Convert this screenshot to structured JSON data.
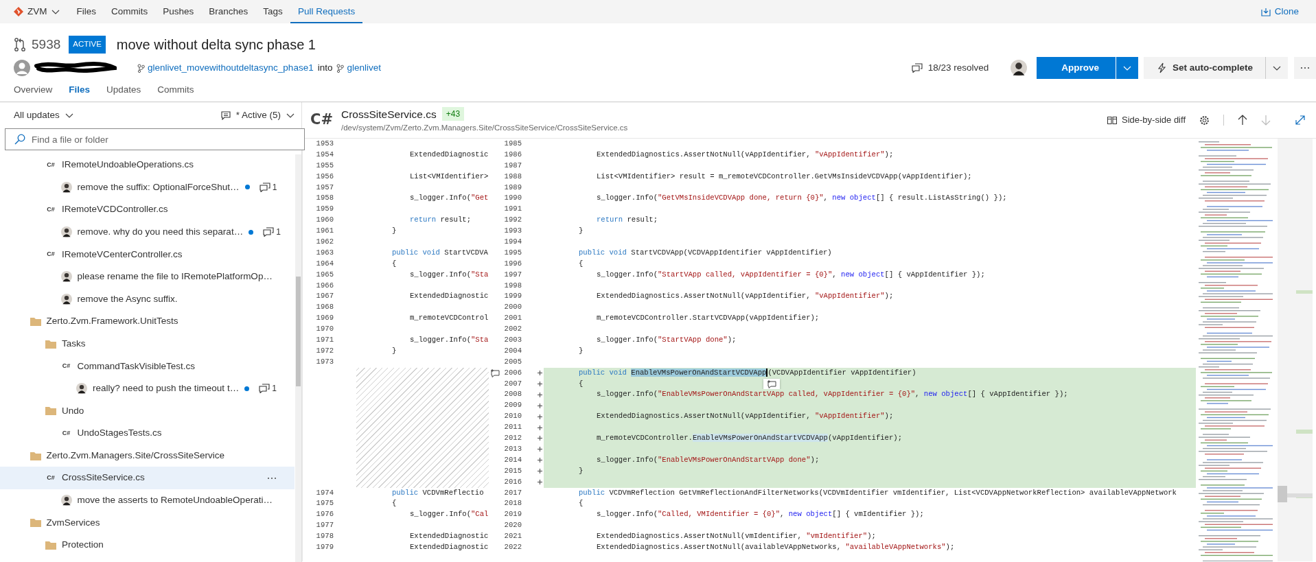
{
  "nav": {
    "project": "ZVM",
    "items": [
      {
        "label": "Files",
        "selected": false
      },
      {
        "label": "Commits",
        "selected": false
      },
      {
        "label": "Pushes",
        "selected": false
      },
      {
        "label": "Branches",
        "selected": false
      },
      {
        "label": "Tags",
        "selected": false
      },
      {
        "label": "Pull Requests",
        "selected": true
      }
    ],
    "clone": "Clone"
  },
  "pull_request": {
    "id": "5938",
    "status": "ACTIVE",
    "title": "move without delta sync phase 1",
    "source_branch": "glenlivet_movewithoutdeltasync_phase1",
    "joiner": "into",
    "target_branch": "glenlivet",
    "resolved": "18/23 resolved",
    "approve": "Approve",
    "auto_complete": "Set auto-complete",
    "tabs": [
      {
        "label": "Overview",
        "selected": false
      },
      {
        "label": "Files",
        "selected": true
      },
      {
        "label": "Updates",
        "selected": false
      },
      {
        "label": "Commits",
        "selected": false
      }
    ]
  },
  "sidebar": {
    "updates_filter": "All updates",
    "comments_filter": "* Active (5)",
    "search": {
      "placeholder": "Find a file or folder"
    },
    "tree": [
      {
        "kind": "folder",
        "children": [
          {
            "kind": "file",
            "language": "C#",
            "label": "IRemoteUndoableOperations.cs",
            "selected": false,
            "children": [
              {
                "kind": "comment",
                "text": "remove the suffix: OptionalForceShut…",
                "unread": true,
                "replies": "1",
                "selected": false
              }
            ]
          },
          {
            "kind": "file",
            "language": "C#",
            "label": "IRemoteVCDController.cs",
            "selected": false,
            "children": [
              {
                "kind": "comment",
                "text": "remove. why do you need this separat…",
                "unread": true,
                "replies": "1",
                "selected": false
              }
            ]
          },
          {
            "kind": "file",
            "language": "C#",
            "label": "IRemoteVCenterController.cs",
            "selected": false,
            "children": [
              {
                "kind": "comment",
                "text": "please rename the file to IRemotePlatformOp…",
                "unread": false,
                "selected": false
              },
              {
                "kind": "comment",
                "text": "remove the Async suffix.",
                "unread": false,
                "selected": false
              }
            ]
          }
        ]
      },
      {
        "kind": "folder",
        "label": "Zerto.Zvm.Framework.UnitTests",
        "selected": false,
        "children": [
          {
            "kind": "folder",
            "label": "Tasks",
            "selected": false,
            "children": [
              {
                "kind": "file",
                "language": "C#",
                "label": "CommandTaskVisibleTest.cs",
                "selected": false,
                "children": [
                  {
                    "kind": "comment",
                    "text": "really? need to push the timeout t…",
                    "unread": true,
                    "replies": "1",
                    "selected": false
                  }
                ]
              }
            ]
          },
          {
            "kind": "folder",
            "label": "Undo",
            "selected": false,
            "children": [
              {
                "kind": "file",
                "language": "C#",
                "label": "UndoStagesTests.cs",
                "selected": false
              }
            ]
          }
        ]
      },
      {
        "kind": "folder",
        "label": "Zerto.Zvm.Managers.Site/CrossSiteService",
        "selected": false,
        "children": [
          {
            "kind": "file",
            "language": "C#",
            "label": "CrossSiteService.cs",
            "selected": true,
            "children": [
              {
                "kind": "comment",
                "text": "move the asserts to RemoteUndoableOperati…",
                "unread": false,
                "selected": false
              }
            ]
          }
        ]
      },
      {
        "kind": "folder",
        "label": "ZvmServices",
        "selected": false,
        "children": [
          {
            "kind": "folder",
            "label": "Protection",
            "selected": false
          }
        ]
      }
    ]
  },
  "file": {
    "language": "C#",
    "name": "CrossSiteService.cs",
    "added": "+43",
    "path": "/dev/system/Zvm/Zerto.Zvm.Managers.Site/CrossSiteService/CrossSiteService.cs",
    "view": "Side-by-side diff"
  },
  "diff": {
    "rows": [
      {
        "left": {
          "number": "1953"
        },
        "right": {
          "number": "1985"
        }
      },
      {
        "kind": "body",
        "left": {
          "number": "1954",
          "code": [
            {
              "kind": "plain",
              "text": "ExtendedDiagnostic"
            }
          ]
        },
        "right": {
          "number": "1986",
          "code": [
            {
              "kind": "plain",
              "text": "ExtendedDiagnostics.AssertNotNull(vAppIdentifier, "
            },
            {
              "kind": "string",
              "text": "\"vAppIdentifier\""
            },
            {
              "kind": "plain",
              "text": ");"
            }
          ]
        }
      },
      {
        "left": {
          "number": "1955"
        },
        "right": {
          "number": "1987"
        }
      },
      {
        "kind": "body",
        "left": {
          "number": "1956",
          "code": [
            {
              "kind": "plain",
              "text": "List<VMIdentifier>"
            }
          ]
        },
        "right": {
          "number": "1988",
          "code": [
            {
              "kind": "plain",
              "text": "List<VMIdentifier> result = m_remoteVCDController.GetVMsInsideVCDVApp(vAppIdentifier);"
            }
          ]
        }
      },
      {
        "left": {
          "number": "1957"
        },
        "right": {
          "number": "1989"
        }
      },
      {
        "kind": "body",
        "left": {
          "number": "1958",
          "code": [
            {
              "kind": "plain",
              "text": "s_logger.Info("
            },
            {
              "kind": "string",
              "text": "\"Get"
            }
          ]
        },
        "right": {
          "number": "1990",
          "code": [
            {
              "kind": "plain",
              "text": "s_logger.Info("
            },
            {
              "kind": "string",
              "text": "\"GetVMsInsideVCDVApp done, return {0}\""
            },
            {
              "kind": "plain",
              "text": ", "
            },
            {
              "kind": "new-keyword",
              "text": "new object"
            },
            {
              "kind": "plain",
              "text": "[] { result.ListAsString() });"
            }
          ]
        }
      },
      {
        "left": {
          "number": "1959"
        },
        "right": {
          "number": "1991"
        }
      },
      {
        "kind": "body",
        "left": {
          "number": "1960",
          "code": [
            {
              "kind": "keyword",
              "text": "return"
            },
            {
              "kind": "plain",
              "text": " result;"
            }
          ]
        },
        "right": {
          "number": "1992",
          "code": [
            {
              "kind": "keyword",
              "text": "return"
            },
            {
              "kind": "plain",
              "text": " result;"
            }
          ]
        }
      },
      {
        "kind": "member",
        "left": {
          "number": "1961",
          "code": [
            {
              "kind": "plain",
              "text": "}"
            }
          ]
        },
        "right": {
          "number": "1993",
          "code": [
            {
              "kind": "plain",
              "text": "}"
            }
          ]
        }
      },
      {
        "left": {
          "number": "1962"
        },
        "right": {
          "number": "1994"
        }
      },
      {
        "kind": "member",
        "left": {
          "number": "1963",
          "code": [
            {
              "kind": "keyword",
              "text": "public void"
            },
            {
              "kind": "plain",
              "text": " StartVCDVA"
            }
          ]
        },
        "right": {
          "number": "1995",
          "code": [
            {
              "kind": "keyword",
              "text": "public void"
            },
            {
              "kind": "plain",
              "text": " StartVCDVApp(VCDVAppIdentifier vAppIdentifier)"
            }
          ]
        }
      },
      {
        "kind": "member",
        "left": {
          "number": "1964",
          "code": [
            {
              "kind": "plain",
              "text": "{"
            }
          ]
        },
        "right": {
          "number": "1996",
          "code": [
            {
              "kind": "plain",
              "text": "{"
            }
          ]
        }
      },
      {
        "kind": "body",
        "left": {
          "number": "1965",
          "code": [
            {
              "kind": "plain",
              "text": "s_logger.Info("
            },
            {
              "kind": "string",
              "text": "\"Sta"
            }
          ]
        },
        "right": {
          "number": "1997",
          "code": [
            {
              "kind": "plain",
              "text": "s_logger.Info("
            },
            {
              "kind": "string",
              "text": "\"StartVApp called, vAppIdentifier = {0}\""
            },
            {
              "kind": "plain",
              "text": ", "
            },
            {
              "kind": "new-keyword",
              "text": "new object"
            },
            {
              "kind": "plain",
              "text": "[] { vAppIdentifier });"
            }
          ]
        }
      },
      {
        "left": {
          "number": "1966"
        },
        "right": {
          "number": "1998"
        }
      },
      {
        "kind": "body",
        "left": {
          "number": "1967",
          "code": [
            {
              "kind": "plain",
              "text": "ExtendedDiagnostic"
            }
          ]
        },
        "right": {
          "number": "1999",
          "code": [
            {
              "kind": "plain",
              "text": "ExtendedDiagnostics.AssertNotNull(vAppIdentifier, "
            },
            {
              "kind": "string",
              "text": "\"vAppIdentifier\""
            },
            {
              "kind": "plain",
              "text": ");"
            }
          ]
        }
      },
      {
        "left": {
          "number": "1968"
        },
        "right": {
          "number": "2000"
        }
      },
      {
        "kind": "body",
        "left": {
          "number": "1969",
          "code": [
            {
              "kind": "plain",
              "text": "m_remoteVCDControl"
            }
          ]
        },
        "right": {
          "number": "2001",
          "code": [
            {
              "kind": "plain",
              "text": "m_remoteVCDController.StartVCDVApp(vAppIdentifier);"
            }
          ]
        }
      },
      {
        "left": {
          "number": "1970"
        },
        "right": {
          "number": "2002"
        }
      },
      {
        "kind": "body",
        "left": {
          "number": "1971",
          "code": [
            {
              "kind": "plain",
              "text": "s_logger.Info("
            },
            {
              "kind": "string",
              "text": "\"Sta"
            }
          ]
        },
        "right": {
          "number": "2003",
          "code": [
            {
              "kind": "plain",
              "text": "s_logger.Info("
            },
            {
              "kind": "string",
              "text": "\"StartVApp done\""
            },
            {
              "kind": "plain",
              "text": ");"
            }
          ]
        }
      },
      {
        "kind": "member",
        "left": {
          "number": "1972",
          "code": [
            {
              "kind": "plain",
              "text": "}"
            }
          ]
        },
        "right": {
          "number": "2004",
          "code": [
            {
              "kind": "plain",
              "text": "}"
            }
          ]
        }
      },
      {
        "left": {
          "number": "1973"
        },
        "right": {
          "number": "2005"
        }
      },
      {
        "added": true,
        "comment_marker": true,
        "kind": "member",
        "right": {
          "number": "2006",
          "code": [
            {
              "kind": "keyword",
              "text": "public void "
            },
            {
              "kind": "selection",
              "text": "EnableVMsPowerOnAndStartVCDVApp"
            },
            {
              "kind": "plain",
              "text": "(VCDVAppIdentifier vAppIdentifier)"
            }
          ]
        }
      },
      {
        "added": true,
        "comment_button": true,
        "kind": "member",
        "right": {
          "number": "2007",
          "code": [
            {
              "kind": "plain",
              "text": "{"
            }
          ]
        }
      },
      {
        "added": true,
        "kind": "body",
        "right": {
          "number": "2008",
          "code": [
            {
              "kind": "plain",
              "text": "s_logger.Info("
            },
            {
              "kind": "string",
              "text": "\"EnableVMsPowerOnAndStartVApp called, vAppIdentifier = {0}\""
            },
            {
              "kind": "plain",
              "text": ", "
            },
            {
              "kind": "new-keyword",
              "text": "new object"
            },
            {
              "kind": "plain",
              "text": "[] { vAppIdentifier });"
            }
          ]
        }
      },
      {
        "added": true,
        "right": {
          "number": "2009"
        }
      },
      {
        "added": true,
        "kind": "body",
        "right": {
          "number": "2010",
          "code": [
            {
              "kind": "plain",
              "text": "ExtendedDiagnostics.AssertNotNull(vAppIdentifier, "
            },
            {
              "kind": "string",
              "text": "\"vAppIdentifier\""
            },
            {
              "kind": "plain",
              "text": ");"
            }
          ]
        }
      },
      {
        "added": true,
        "right": {
          "number": "2011"
        }
      },
      {
        "added": true,
        "kind": "body",
        "right": {
          "number": "2012",
          "code": [
            {
              "kind": "plain",
              "text": "m_remoteVCDController."
            },
            {
              "kind": "match",
              "text": "EnableVMsPowerOnAndStartVCDVApp"
            },
            {
              "kind": "plain",
              "text": "(vAppIdentifier);"
            }
          ]
        }
      },
      {
        "added": true,
        "right": {
          "number": "2013"
        }
      },
      {
        "added": true,
        "kind": "body",
        "right": {
          "number": "2014",
          "code": [
            {
              "kind": "plain",
              "text": "s_logger.Info("
            },
            {
              "kind": "string",
              "text": "\"EnableVMsPowerOnAndStartVApp done\""
            },
            {
              "kind": "plain",
              "text": ");"
            }
          ]
        }
      },
      {
        "added": true,
        "kind": "member",
        "right": {
          "number": "2015",
          "code": [
            {
              "kind": "plain",
              "text": "}"
            }
          ]
        }
      },
      {
        "added": true,
        "right": {
          "number": "2016"
        }
      },
      {
        "kind": "member",
        "left": {
          "number": "1974",
          "code": [
            {
              "kind": "keyword",
              "text": "public"
            },
            {
              "kind": "plain",
              "text": " VCDVmReflectio"
            }
          ]
        },
        "right": {
          "number": "2017",
          "code": [
            {
              "kind": "keyword",
              "text": "public"
            },
            {
              "kind": "plain",
              "text": " VCDVmReflection GetVmReflectionAndFilterNetworks(VCDVmIdentifier vmIdentifier, List<VCDVAppNetworkReflection> availableVAppNetwork"
            }
          ]
        }
      },
      {
        "kind": "member",
        "left": {
          "number": "1975",
          "code": [
            {
              "kind": "plain",
              "text": "{"
            }
          ]
        },
        "right": {
          "number": "2018",
          "code": [
            {
              "kind": "plain",
              "text": "{"
            }
          ]
        }
      },
      {
        "kind": "body",
        "left": {
          "number": "1976",
          "code": [
            {
              "kind": "plain",
              "text": "s_logger.Info("
            },
            {
              "kind": "string",
              "text": "\"Cal"
            }
          ]
        },
        "right": {
          "number": "2019",
          "code": [
            {
              "kind": "plain",
              "text": "s_logger.Info("
            },
            {
              "kind": "string",
              "text": "\"Called, VMIdentifier = {0}\""
            },
            {
              "kind": "plain",
              "text": ", "
            },
            {
              "kind": "new-keyword",
              "text": "new object"
            },
            {
              "kind": "plain",
              "text": "[] { vmIdentifier });"
            }
          ]
        }
      },
      {
        "left": {
          "number": "1977"
        },
        "right": {
          "number": "2020"
        }
      },
      {
        "kind": "body",
        "left": {
          "number": "1978",
          "code": [
            {
              "kind": "plain",
              "text": "ExtendedDiagnostic"
            }
          ]
        },
        "right": {
          "number": "2021",
          "code": [
            {
              "kind": "plain",
              "text": "ExtendedDiagnostics.AssertNotNull(vmIdentifier, "
            },
            {
              "kind": "string",
              "text": "\"vmIdentifier\""
            },
            {
              "kind": "plain",
              "text": ");"
            }
          ]
        }
      },
      {
        "kind": "body",
        "left": {
          "number": "1979",
          "code": [
            {
              "kind": "plain",
              "text": "ExtendedDiagnostic"
            }
          ]
        },
        "right": {
          "number": "2022",
          "code": [
            {
              "kind": "plain",
              "text": "ExtendedDiagnostics.AssertNotNull(availableVAppNetworks, "
            },
            {
              "kind": "string",
              "text": "\"availableVAppNetworks\""
            },
            {
              "kind": "plain",
              "text": ");"
            }
          ]
        }
      }
    ]
  }
}
